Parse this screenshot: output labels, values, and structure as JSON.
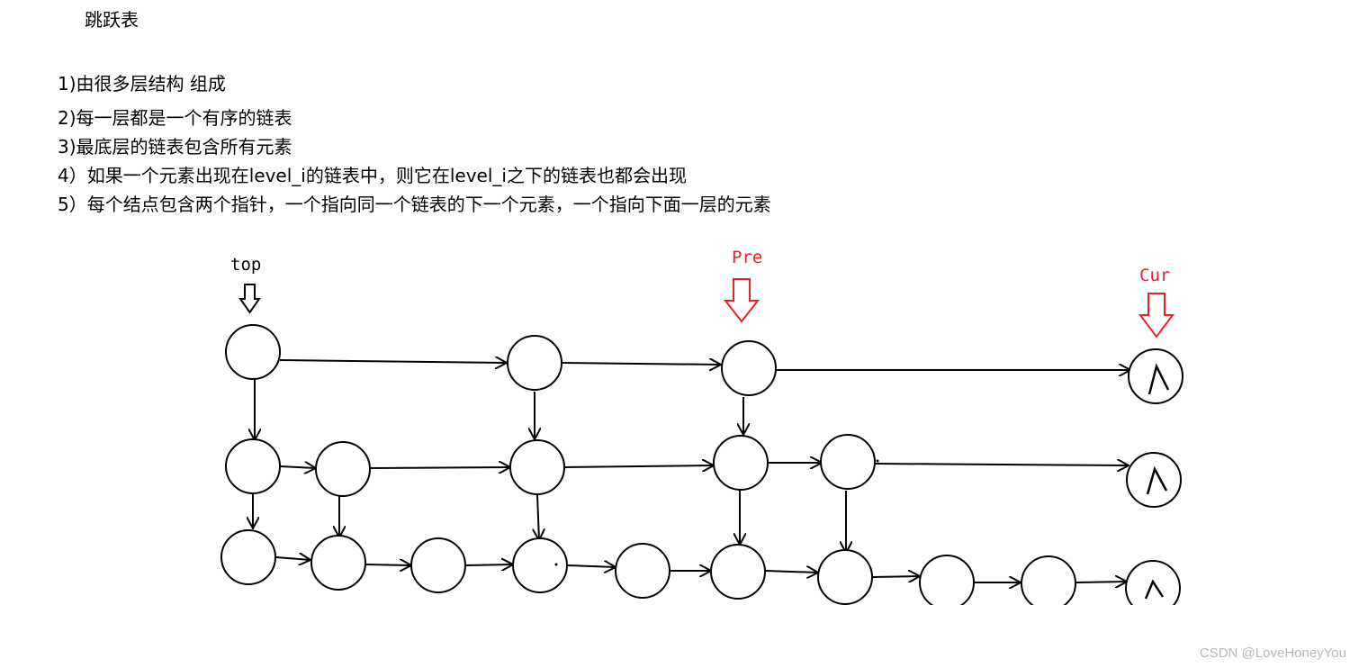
{
  "title": "跳跃表",
  "rules": [
    "1)由很多层结构 组成",
    "2)每一层都是一个有序的链表",
    "3)最底层的链表包含所有元素",
    "4）如果一个元素出现在level_i的链表中，则它在level_i之下的链表也都会出现",
    "5）每个结点包含两个指针，一个指向同一个链表的下一个元素，一个指向下面一层的元素"
  ],
  "labels": {
    "top": "top",
    "pre": "Pre",
    "cur": "Cur"
  },
  "colors": {
    "pointer_red": "#e8212b",
    "ink": "#000000"
  },
  "watermark": "CSDN @LoveHoneyYou"
}
